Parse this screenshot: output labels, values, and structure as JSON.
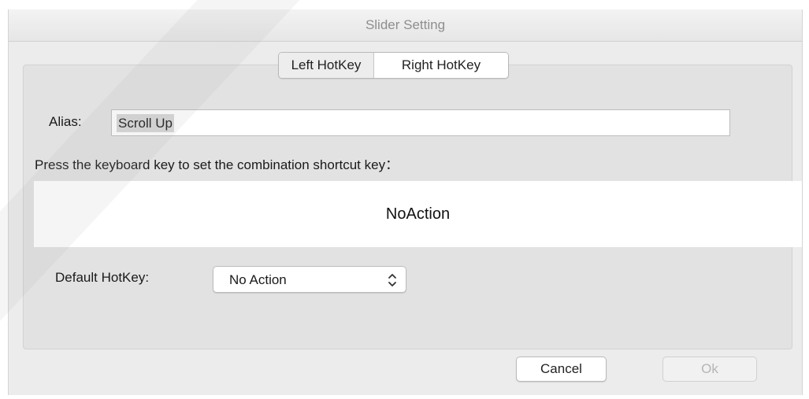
{
  "window": {
    "title": "Slider Setting"
  },
  "tabs": [
    {
      "label": "Left HotKey",
      "selected": false
    },
    {
      "label": "Right HotKey",
      "selected": true
    }
  ],
  "alias": {
    "label": "Alias:",
    "value": "Scroll Up"
  },
  "shortcut": {
    "prompt": "Press the keyboard key to set the combination shortcut key：",
    "value": "NoAction"
  },
  "default_hotkey": {
    "label": "Default HotKey:",
    "selected": "No Action",
    "icon": "chevron-updown-icon"
  },
  "buttons": {
    "cancel": "Cancel",
    "ok": "Ok"
  },
  "colors": {
    "window_bg": "#ececec",
    "panel_bg": "#e2e2e2",
    "disabled_text": "#b5b5b5"
  }
}
